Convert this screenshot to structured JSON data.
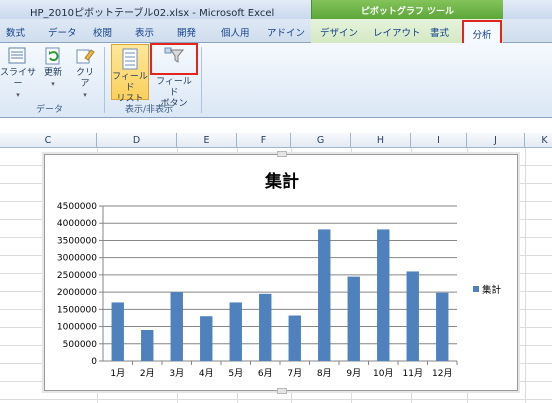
{
  "window": {
    "title": "HP_2010ピボットテーブル02.xlsx - Microsoft Excel",
    "context_title": "ピボットグラフ ツール"
  },
  "tabs": [
    "数式",
    "データ",
    "校閲",
    "表示",
    "開発",
    "個人用",
    "アドイン",
    "デザイン",
    "レイアウト",
    "書式",
    "分析"
  ],
  "active_tab": "分析",
  "ribbon": {
    "data_group": {
      "label": "データ",
      "slicer": "スライサー",
      "refresh": "更新",
      "clear": "クリア"
    },
    "show_group": {
      "label": "表示/非表示",
      "field_list_line1": "フィールド",
      "field_list_line2": "リスト",
      "field_button_line1": "フィールド",
      "field_button_line2": "ボタン"
    }
  },
  "columns": [
    "C",
    "D",
    "E",
    "F",
    "G",
    "H",
    "I",
    "J",
    "K"
  ],
  "colors": {
    "bar": "#4f81bd",
    "accent_red": "#e0261d",
    "context_green": "#6ab344"
  },
  "chart_data": {
    "type": "bar",
    "title": "集計",
    "categories": [
      "1月",
      "2月",
      "3月",
      "4月",
      "5月",
      "6月",
      "7月",
      "8月",
      "9月",
      "10月",
      "11月",
      "12月"
    ],
    "series": [
      {
        "name": "集計",
        "values": [
          1700000,
          900000,
          2000000,
          1300000,
          1700000,
          1950000,
          1320000,
          3820000,
          2450000,
          3820000,
          2600000,
          1980000
        ]
      }
    ],
    "ylim": [
      0,
      4500000
    ],
    "yticks": [
      0,
      500000,
      1000000,
      1500000,
      2000000,
      2500000,
      3000000,
      3500000,
      4000000,
      4500000
    ],
    "grid": true,
    "legend": "right"
  }
}
